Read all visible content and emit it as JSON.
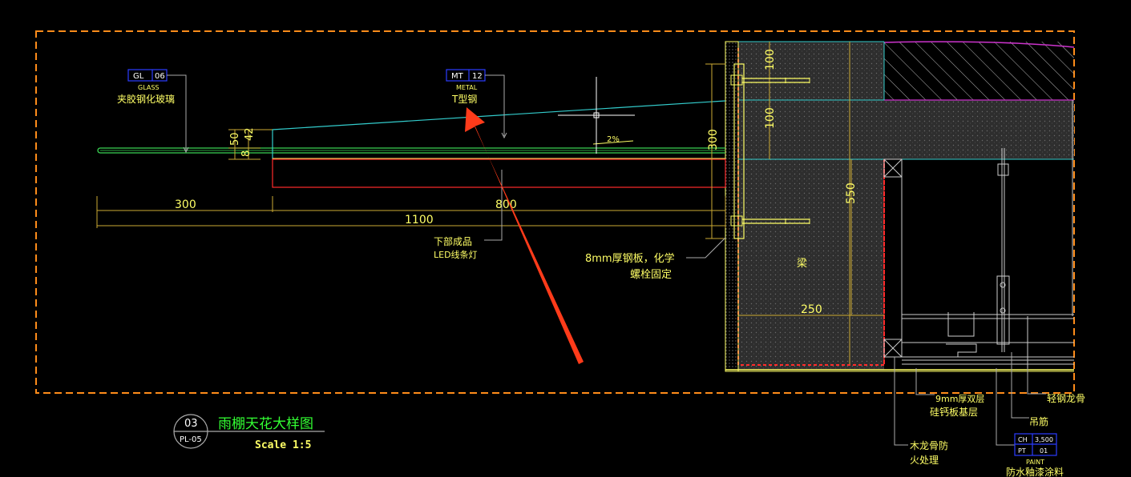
{
  "colors": {
    "background": "#000000",
    "frame": "#ff8c1a",
    "glass": "#39d353",
    "steel": "#ffff66",
    "cyan": "#33cccc",
    "red": "#ff2a2a",
    "concrete": "#3a3a3a",
    "magenta": "#cc33cc",
    "tag_blue": "#2b3cff",
    "white": "#ffffff",
    "arrow": "#ff3b1a",
    "title_green": "#33ff33"
  },
  "tags": {
    "glass": {
      "code": "GL",
      "number": "06",
      "en": "GLASS",
      "cn": "夹胶钢化玻璃"
    },
    "metal": {
      "code": "MT",
      "number": "12",
      "en": "METAL",
      "cn": "T型钢"
    },
    "paint": {
      "code1": "CH",
      "value1": "3,500",
      "code2": "PT",
      "value2": "01",
      "en": "PAINT",
      "cn": "防水釉漆涂料"
    }
  },
  "dimensions": {
    "d300_horizontal": "300",
    "d800": "800",
    "d1100": "1100",
    "d50": "50",
    "d42": "42",
    "d8": "8",
    "d300_vertical": "300",
    "d100_a": "100",
    "d100_b": "100",
    "d550": "550",
    "d250": "250",
    "slope": "2%"
  },
  "labels": {
    "led_line1": "下部成品",
    "led_line2": "LED线条灯",
    "plate_line1": "8mm厚钢板，化学",
    "plate_line2": "螺栓固定",
    "beam": "梁",
    "light_keel": "轻钢龙骨",
    "board_line1": "9mm厚双层",
    "board_line2": "硅钙板基层",
    "hanger": "吊筋",
    "wood_keel_line1": "木龙骨防",
    "wood_keel_line2": "火处理"
  },
  "title": {
    "number": "03",
    "sheet": "PL-05",
    "name": "雨棚天花大样图",
    "scale": "Scale 1:5"
  }
}
